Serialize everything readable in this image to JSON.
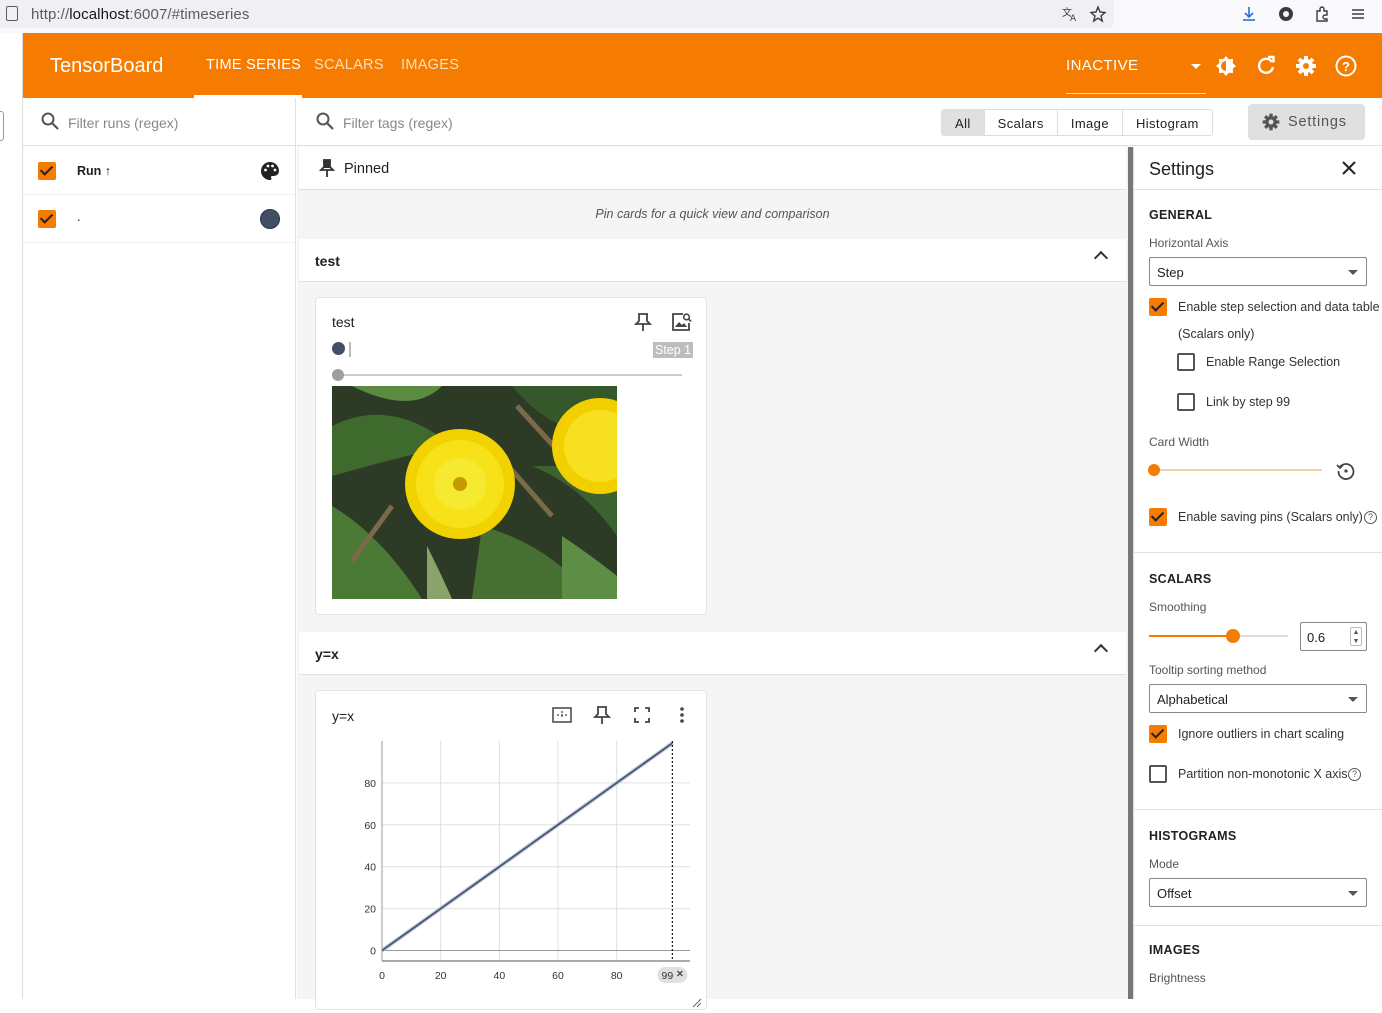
{
  "browser": {
    "url_prefix": "http://",
    "url_host": "localhost",
    "url_rest": ":6007/#timeseries"
  },
  "header": {
    "brand": "TensorBoard",
    "tabs": [
      "TIME SERIES",
      "SCALARS",
      "IMAGES"
    ],
    "active_tab": "TIME SERIES",
    "reload_status": "INACTIVE",
    "colors": {
      "accent": "#f57c00"
    }
  },
  "runs": {
    "filter_placeholder": "Filter runs (regex)",
    "column_header": "Run ↑",
    "items": [
      {
        "name": ".",
        "checked": true,
        "color": "#425066"
      }
    ]
  },
  "main": {
    "tag_filter_placeholder": "Filter tags (regex)",
    "type_filters": [
      "All",
      "Scalars",
      "Image",
      "Histogram"
    ],
    "selected_type": "All",
    "settings_button": "Settings",
    "pinned": {
      "title": "Pinned",
      "empty_message": "Pin cards for a quick view and comparison"
    },
    "groups": [
      {
        "title": "test",
        "card": {
          "title": "test",
          "step_label": "Step 1",
          "image_alt": "dandelion"
        }
      },
      {
        "title": "y=x",
        "card": {
          "title": "y=x"
        }
      }
    ]
  },
  "chart_data": {
    "type": "line",
    "title": "y=x",
    "xlabel": "",
    "ylabel": "",
    "x_ticks": [
      "0",
      "20",
      "40",
      "60",
      "80"
    ],
    "y_ticks": [
      "0",
      "20",
      "40",
      "60",
      "80"
    ],
    "xlim": [
      0,
      105
    ],
    "ylim": [
      -5,
      100
    ],
    "grid": true,
    "selected_step_label": "99",
    "selected_step": 99,
    "series": [
      {
        "color": "#425066",
        "x": [
          0,
          10,
          20,
          30,
          40,
          50,
          60,
          70,
          80,
          90,
          99
        ],
        "y": [
          0,
          10,
          20,
          30,
          40,
          50,
          60,
          70,
          80,
          90,
          99
        ]
      }
    ]
  },
  "settings": {
    "title": "Settings",
    "general": {
      "heading": "GENERAL",
      "horizontal_axis_label": "Horizontal Axis",
      "horizontal_axis_value": "Step",
      "step_selection_label_1": "Enable step selection and data table",
      "step_selection_label_2": "(Scalars only)",
      "range_selection_label": "Enable Range Selection",
      "link_by_step_label": "Link by step 99",
      "card_width_label": "Card Width",
      "saving_pins_label": "Enable saving pins (Scalars only)"
    },
    "scalars": {
      "heading": "SCALARS",
      "smoothing_label": "Smoothing",
      "smoothing_value": "0.6",
      "smoothing": 0.6,
      "tooltip_sort_label": "Tooltip sorting method",
      "tooltip_sort_value": "Alphabetical",
      "ignore_outliers_label": "Ignore outliers in chart scaling",
      "partition_label": "Partition non-monotonic X axis"
    },
    "histograms": {
      "heading": "HISTOGRAMS",
      "mode_label": "Mode",
      "mode_value": "Offset"
    },
    "images": {
      "heading": "IMAGES",
      "brightness_label": "Brightness"
    }
  }
}
